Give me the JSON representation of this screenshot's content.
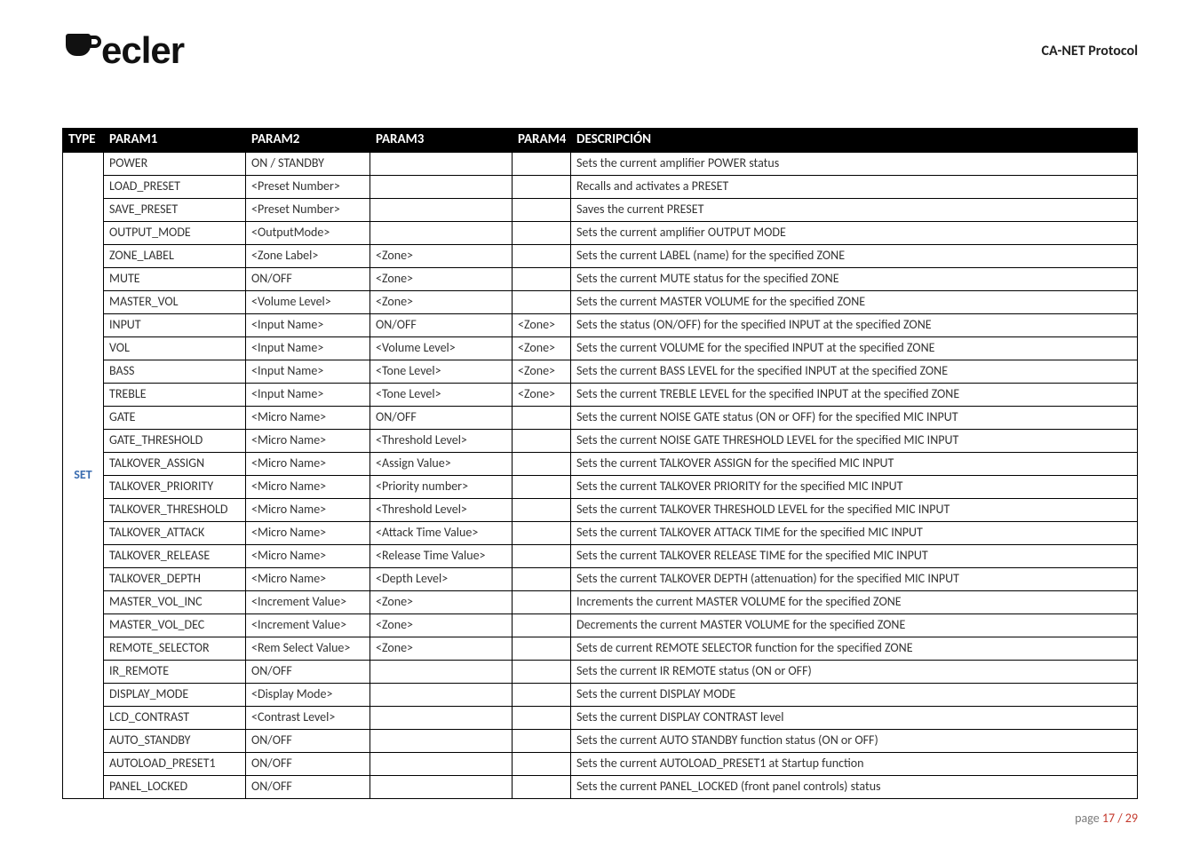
{
  "header": {
    "logo_text": "ecler",
    "doc_title": "CA-NET Protocol"
  },
  "table": {
    "headers": {
      "type": "TYPE",
      "param1": "PARAM1",
      "param2": "PARAM2",
      "param3": "PARAM3",
      "param4": "PARAM4",
      "desc": "DESCRIPCIÓN"
    },
    "type_label": "SET",
    "rows": [
      {
        "p1": "POWER",
        "p2": "ON / STANDBY",
        "p3": "",
        "p4": "",
        "d": "Sets the current amplifier POWER status"
      },
      {
        "p1": "LOAD_PRESET",
        "p2": "<Preset Number>",
        "p3": "",
        "p4": "",
        "d": "Recalls and activates a PRESET"
      },
      {
        "p1": "SAVE_PRESET",
        "p2": "<Preset Number>",
        "p3": "",
        "p4": "",
        "d": "Saves the current PRESET"
      },
      {
        "p1": "OUTPUT_MODE",
        "p2": "<OutputMode>",
        "p3": "",
        "p4": "",
        "d": "Sets the current amplifier OUTPUT MODE"
      },
      {
        "p1": "ZONE_LABEL",
        "p2": "<Zone Label>",
        "p3": "<Zone>",
        "p4": "",
        "d": "Sets the current LABEL (name) for the specified ZONE"
      },
      {
        "p1": "MUTE",
        "p2": "ON/OFF",
        "p3": "<Zone>",
        "p4": "",
        "d": "Sets the current MUTE status for the specified ZONE"
      },
      {
        "p1": "MASTER_VOL",
        "p2": "<Volume Level>",
        "p3": "<Zone>",
        "p4": "",
        "d": "Sets the current MASTER VOLUME  for the specified ZONE"
      },
      {
        "p1": "INPUT",
        "p2": "<Input Name>",
        "p3": "ON/OFF",
        "p4": "<Zone>",
        "d": "Sets the status (ON/OFF) for the specified INPUT at the specified ZONE"
      },
      {
        "p1": "VOL",
        "p2": "<Input Name>",
        "p3": "<Volume Level>",
        "p4": "<Zone>",
        "d": "Sets the current VOLUME for the specified INPUT at the specified ZONE"
      },
      {
        "p1": "BASS",
        "p2": "<Input Name>",
        "p3": "<Tone Level>",
        "p4": "<Zone>",
        "d": "Sets the current BASS LEVEL for the specified INPUT at the specified ZONE"
      },
      {
        "p1": "TREBLE",
        "p2": "<Input Name>",
        "p3": "<Tone Level>",
        "p4": "<Zone>",
        "d": "Sets the current TREBLE LEVEL for the specified INPUT at the specified ZONE"
      },
      {
        "p1": "GATE",
        "p2": "<Micro Name>",
        "p3": "ON/OFF",
        "p4": "",
        "d": "Sets the current NOISE GATE status (ON or OFF) for the specified MIC INPUT"
      },
      {
        "p1": "GATE_THRESHOLD",
        "p2": "<Micro Name>",
        "p3": "<Threshold Level>",
        "p4": "",
        "d": "Sets the current NOISE GATE THRESHOLD LEVEL for the specified MIC INPUT"
      },
      {
        "p1": "TALKOVER_ASSIGN",
        "p2": "<Micro Name>",
        "p3": "<Assign Value>",
        "p4": "",
        "d": "Sets the current TALKOVER ASSIGN for the specified MIC INPUT"
      },
      {
        "p1": "TALKOVER_PRIORITY",
        "p2": "<Micro Name>",
        "p3": "<Priority number>",
        "p4": "",
        "d": "Sets the current TALKOVER PRIORITY for the specified MIC INPUT"
      },
      {
        "p1": "TALKOVER_THRESHOLD",
        "p2": "<Micro Name>",
        "p3": "<Threshold Level>",
        "p4": "",
        "d": "Sets the current TALKOVER THRESHOLD LEVEL for the specified MIC INPUT"
      },
      {
        "p1": "TALKOVER_ATTACK",
        "p2": "<Micro Name>",
        "p3": "<Attack Time Value>",
        "p4": "",
        "d": "Sets the current TALKOVER ATTACK TIME for the specified MIC INPUT"
      },
      {
        "p1": "TALKOVER_RELEASE",
        "p2": "<Micro Name>",
        "p3": "<Release Time Value>",
        "p4": "",
        "d": "Sets the current TALKOVER RELEASE TIME for the specified MIC INPUT"
      },
      {
        "p1": "TALKOVER_DEPTH",
        "p2": "<Micro Name>",
        "p3": "<Depth Level>",
        "p4": "",
        "d": "Sets the current TALKOVER DEPTH (attenuation) for the specified MIC INPUT"
      },
      {
        "p1": "MASTER_VOL_INC",
        "p2": "<Increment Value>",
        "p3": "<Zone>",
        "p4": "",
        "d": "Increments the current MASTER VOLUME for the specified ZONE"
      },
      {
        "p1": "MASTER_VOL_DEC",
        "p2": "<Increment Value>",
        "p3": "<Zone>",
        "p4": "",
        "d": "Decrements the current MASTER VOLUME for the specified ZONE"
      },
      {
        "p1": "REMOTE_SELECTOR",
        "p2": "<Rem Select Value>",
        "p3": "<Zone>",
        "p4": "",
        "d": "Sets de current REMOTE SELECTOR function for the specified ZONE"
      },
      {
        "p1": "IR_REMOTE",
        "p2": "ON/OFF",
        "p3": "",
        "p4": "",
        "d": "Sets the current IR REMOTE status (ON or OFF)"
      },
      {
        "p1": "DISPLAY_MODE",
        "p2": "<Display Mode>",
        "p3": "",
        "p4": "",
        "d": "Sets the current DISPLAY MODE"
      },
      {
        "p1": "LCD_CONTRAST",
        "p2": "<Contrast Level>",
        "p3": "",
        "p4": "",
        "d": "Sets the current DISPLAY CONTRAST level"
      },
      {
        "p1": "AUTO_STANDBY",
        "p2": "ON/OFF",
        "p3": "",
        "p4": "",
        "d": "Sets the current AUTO STANDBY function status (ON or OFF)"
      },
      {
        "p1": "AUTOLOAD_PRESET1",
        "p2": "ON/OFF",
        "p3": "",
        "p4": "",
        "d": "Sets the current AUTOLOAD_PRESET1 at Startup function"
      },
      {
        "p1": "PANEL_LOCKED",
        "p2": "ON/OFF",
        "p3": "",
        "p4": "",
        "d": "Sets  the current PANEL_LOCKED (front panel controls) status"
      }
    ]
  },
  "footer": {
    "label": "page  ",
    "current": "17",
    "sep": " / ",
    "total": "29"
  }
}
